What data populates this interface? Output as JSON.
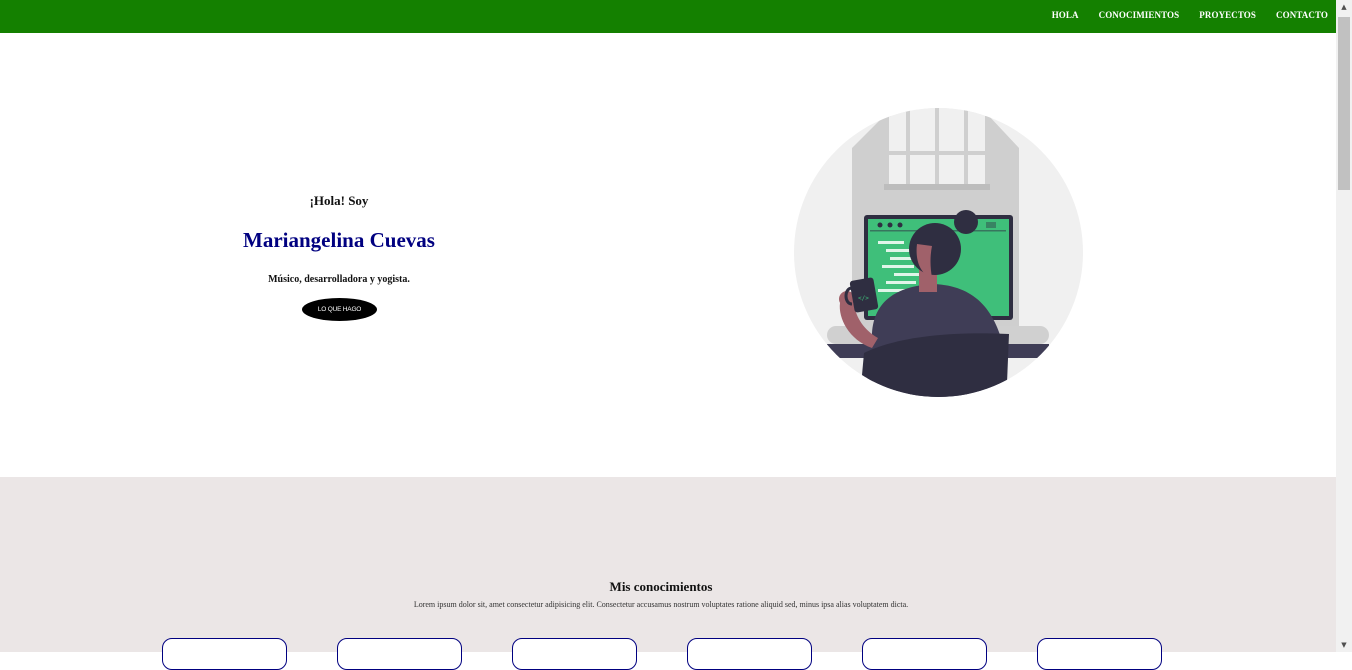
{
  "nav": {
    "items": [
      {
        "label": "HOLA"
      },
      {
        "label": "CONOCIMIENTOS"
      },
      {
        "label": "PROYECTOS"
      },
      {
        "label": "CONTACTO"
      }
    ]
  },
  "hero": {
    "greeting": "¡Hola! Soy",
    "name": "Mariangelina Cuevas",
    "tagline": "Músico, desarrolladora y yogista.",
    "cta_label": "LO QUE HAGO"
  },
  "skills": {
    "title": "Mis conocimientos",
    "description": "Lorem ipsum dolor sit, amet consectetur adipisicing elit. Consectetur accusamus nostrum voluptates ratione aliquid sed, minus ipsa alias voluptatem dicta.",
    "card_count": 6
  },
  "colors": {
    "nav_bg": "#148000",
    "name_color": "#000080",
    "skills_bg": "#ebe6e6",
    "card_border": "#000080",
    "screen_green": "#3fbf7a"
  },
  "scrollbar": {
    "up_icon": "arrow-up-icon",
    "down_icon": "arrow-down-icon"
  }
}
